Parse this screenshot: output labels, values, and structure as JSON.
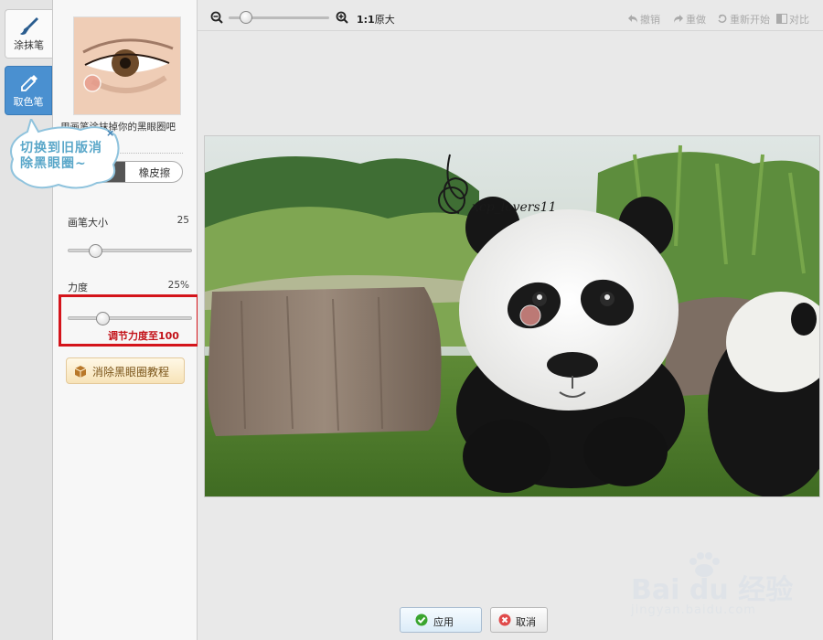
{
  "tools": {
    "brush": {
      "label": "涂抹笔",
      "icon": "brush-icon"
    },
    "picker": {
      "label": "取色笔",
      "icon": "eyedropper-icon"
    }
  },
  "options": {
    "preview_caption": "用画笔涂抹掉你的黑眼圈吧",
    "mode_toggle_label": "橡皮擦",
    "brush_size": {
      "label": "画笔大小",
      "value": "25",
      "fraction": 0.18
    },
    "strength": {
      "label": "力度",
      "value": "25%",
      "fraction": 0.25
    },
    "strength_hint": "调节力度至100",
    "tutorial_button": "消除黑眼圈教程"
  },
  "tip": {
    "text": "切换到旧版消除黑眼圈~",
    "close": "×"
  },
  "toolbar": {
    "actual_size_ratio": "1:1",
    "actual_size_label": "原大",
    "undo": "撤销",
    "redo": "重做",
    "restart": "重新开始",
    "compare": "对比"
  },
  "photo": {
    "watermark": "xcp_lovers11"
  },
  "footer": {
    "apply": "应用",
    "cancel": "取消"
  },
  "watermark": {
    "word": "Bai du 经验",
    "url": "jingyan.baidu.com"
  },
  "colors": {
    "accent_blue": "#4a90d0",
    "highlight_red": "#d4141b"
  }
}
